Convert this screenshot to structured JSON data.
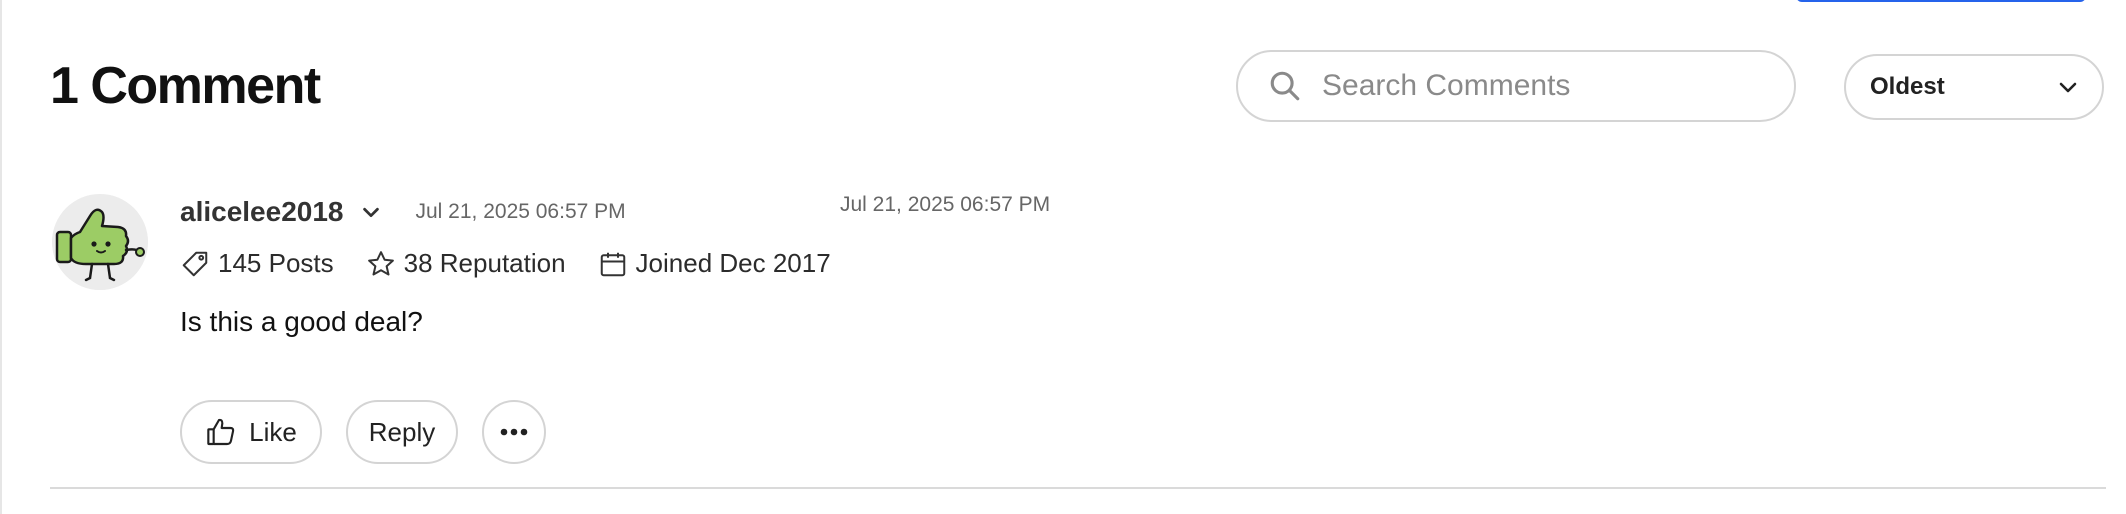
{
  "header": {
    "title": "1 Comment",
    "search": {
      "placeholder": "Search Comments",
      "icon": "search-icon"
    },
    "sort": {
      "selected": "Oldest",
      "icon": "chevron-down-icon"
    }
  },
  "comment": {
    "author": {
      "username": "alicelee2018",
      "avatar": "thumbs-up-mascot-avatar",
      "stats": [
        {
          "icon": "tag-icon",
          "text": "145 Posts"
        },
        {
          "icon": "star-icon",
          "text": "38 Reputation"
        },
        {
          "icon": "calendar-icon",
          "text": "Joined Dec 2017"
        }
      ]
    },
    "timestamp": "Jul 21, 2025 06:57 PM",
    "timestamp_secondary": "Jul 21, 2025 06:57 PM",
    "body": "Is this a good deal?",
    "actions": {
      "like_label": "Like",
      "reply_label": "Reply",
      "more_icon": "more-horizontal-icon"
    }
  },
  "colors": {
    "accent": "#2563eb",
    "avatar_green": "#9ccc65",
    "border": "#d4d4d4",
    "muted_text": "#666666"
  }
}
